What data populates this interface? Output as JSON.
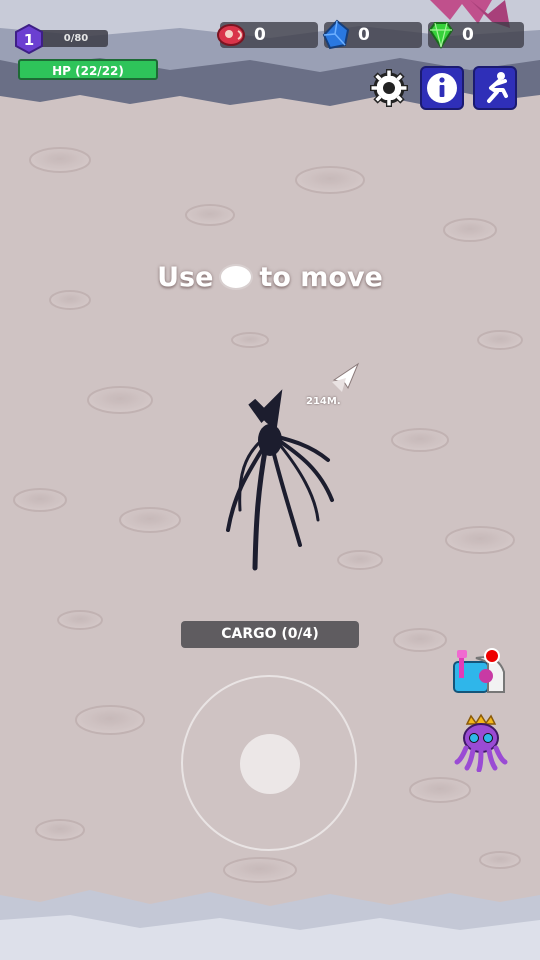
{
  "hud": {
    "level": "1",
    "xp_text": "0/80",
    "hp_text": "HP (22/22)",
    "resources": [
      {
        "name": "meat",
        "icon": "meat-icon",
        "value": "0",
        "color": "#d9344a"
      },
      {
        "name": "blue-gem",
        "icon": "blue-crystal-icon",
        "value": "0",
        "color": "#2a78e0"
      },
      {
        "name": "green-gem",
        "icon": "green-diamond-icon",
        "value": "0",
        "color": "#36d23a"
      }
    ]
  },
  "buttons": {
    "settings_icon": "gear-icon",
    "info_icon": "info-icon",
    "run_icon": "running-figure-icon"
  },
  "hint": {
    "before": "Use",
    "after": "to move"
  },
  "objective": {
    "distance_text": "214M."
  },
  "cargo": {
    "text": "CARGO (0/4)"
  },
  "side_buttons": [
    {
      "name": "shop-mailbox",
      "icon": "mailbox-icon",
      "has_notification": true
    },
    {
      "name": "boss-octopus",
      "icon": "crowned-octopus-icon"
    }
  ],
  "colors": {
    "ground": "#cfc3c3",
    "hp_green": "#2ec45a",
    "button_blue": "#2f2fb8",
    "level_purple": "#6b3fd1"
  }
}
